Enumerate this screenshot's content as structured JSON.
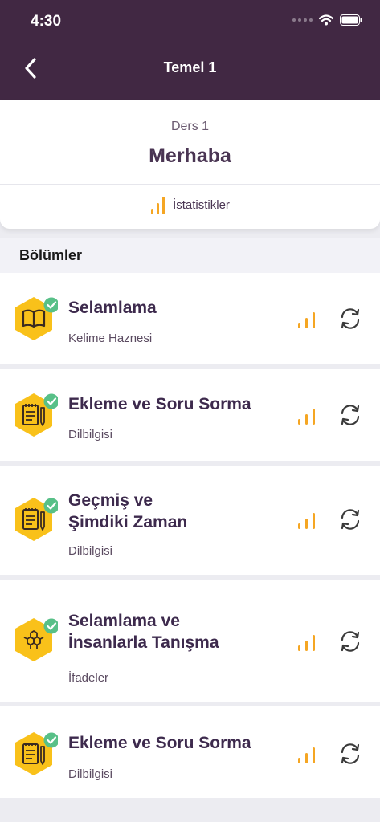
{
  "status": {
    "time": "4:30"
  },
  "nav": {
    "title": "Temel 1"
  },
  "lesson": {
    "subtitle": "Ders 1",
    "title": "Merhaba",
    "stats_label": "İstatistikler"
  },
  "section": {
    "title": "Bölümler"
  },
  "items": [
    {
      "title": "Selamlama",
      "category": "Kelime Haznesi",
      "icon": "book-icon",
      "completed": true
    },
    {
      "title": "Ekleme ve Soru Sorma",
      "category": "Dilbilgisi",
      "icon": "notepad-icon",
      "completed": true
    },
    {
      "title": "Geçmiş ve Şimdiki Zaman",
      "category": "Dilbilgisi",
      "icon": "notepad-icon",
      "completed": true
    },
    {
      "title": "Selamlama ve İnsanlarla Tanışma",
      "category": "İfadeler",
      "icon": "hexagon-grid-icon",
      "completed": true
    },
    {
      "title": "Ekleme ve Soru Sorma",
      "category": "Dilbilgisi",
      "icon": "notepad-icon",
      "completed": true
    }
  ],
  "colors": {
    "header": "#412843",
    "accent": "#f5a623",
    "check": "#58c088",
    "hex": "#f9c11a"
  }
}
